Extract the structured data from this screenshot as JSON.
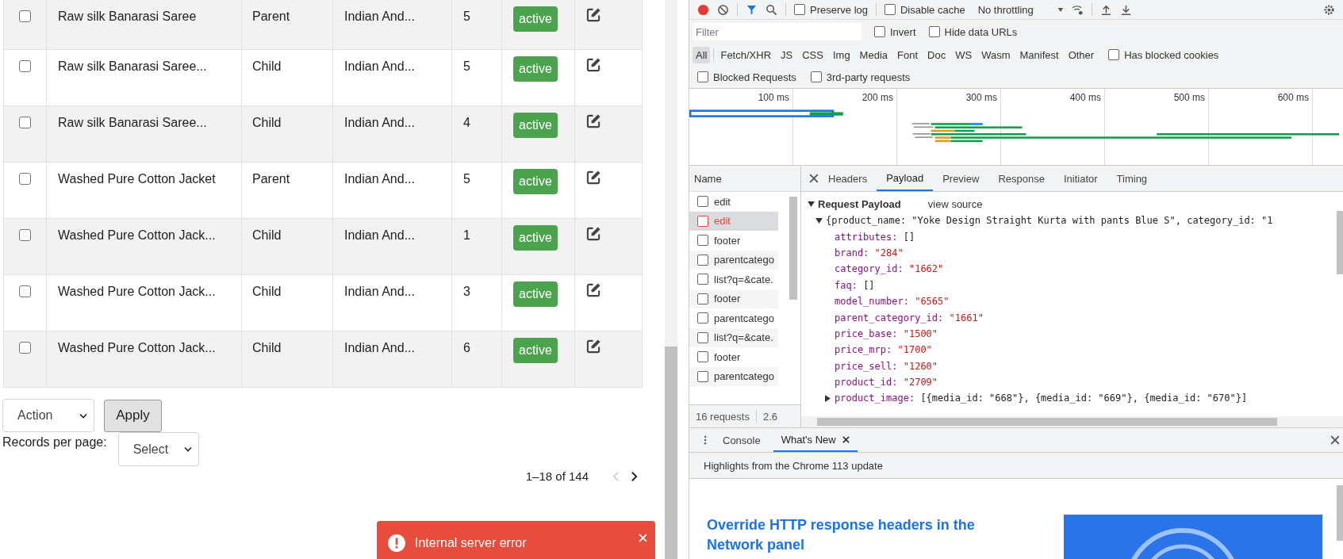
{
  "product_table": {
    "rows": [
      {
        "selected": false,
        "name": "Raw silk Banarasi Saree",
        "type": "Parent",
        "brand": "Indian And...",
        "quantity": "5",
        "status": "active"
      },
      {
        "selected": false,
        "name": "Raw silk Banarasi Saree...",
        "type": "Child",
        "brand": "Indian And...",
        "quantity": "5",
        "status": "active"
      },
      {
        "selected": false,
        "name": "Raw silk Banarasi Saree...",
        "type": "Child",
        "brand": "Indian And...",
        "quantity": "4",
        "status": "active"
      },
      {
        "selected": false,
        "name": "Washed Pure Cotton Jacket",
        "type": "Parent",
        "brand": "Indian And...",
        "quantity": "5",
        "status": "active"
      },
      {
        "selected": false,
        "name": "Washed Pure Cotton Jack...",
        "type": "Child",
        "brand": "Indian And...",
        "quantity": "1",
        "status": "active"
      },
      {
        "selected": false,
        "name": "Washed Pure Cotton Jack...",
        "type": "Child",
        "brand": "Indian And...",
        "quantity": "3",
        "status": "active"
      },
      {
        "selected": false,
        "name": "Washed Pure Cotton Jack...",
        "type": "Child",
        "brand": "Indian And...",
        "quantity": "6",
        "status": "active"
      }
    ]
  },
  "bulk_action": {
    "select": "Action",
    "button": "Apply"
  },
  "records_per_page": {
    "label": "Records per page:",
    "select": "Select"
  },
  "pagination": {
    "range": "1–18 of 144",
    "prev_disabled": true
  },
  "toast": {
    "message": "Internal server error"
  },
  "devtools": {
    "toolbar": {
      "preserve_log": {
        "label": "Preserve log",
        "checked": false
      },
      "disable_cache": {
        "label": "Disable cache",
        "checked": false
      },
      "throttling": "No throttling"
    },
    "filter": {
      "placeholder": "Filter",
      "invert": {
        "label": "Invert",
        "checked": false
      },
      "hide_data_urls": {
        "label": "Hide data URLs",
        "checked": false
      }
    },
    "type_filters": [
      {
        "label": "All",
        "selected": true
      },
      {
        "label": "Fetch/XHR",
        "selected": false
      },
      {
        "label": "JS",
        "selected": false
      },
      {
        "label": "CSS",
        "selected": false
      },
      {
        "label": "Img",
        "selected": false
      },
      {
        "label": "Media",
        "selected": false
      },
      {
        "label": "Font",
        "selected": false
      },
      {
        "label": "Doc",
        "selected": false
      },
      {
        "label": "WS",
        "selected": false
      },
      {
        "label": "Wasm",
        "selected": false
      },
      {
        "label": "Manifest",
        "selected": false
      },
      {
        "label": "Other",
        "selected": false
      }
    ],
    "has_blocked_cookies": {
      "label": "Has blocked cookies",
      "checked": false
    },
    "blocked_requests": {
      "label": "Blocked Requests",
      "checked": false
    },
    "third_party_requests": {
      "label": "3rd-party requests",
      "checked": false
    },
    "overview": {
      "ticks": [
        "100 ms",
        "200 ms",
        "300 ms",
        "400 ms",
        "500 ms",
        "600 ms"
      ]
    },
    "requests": {
      "header": "Name",
      "items": [
        {
          "name": "edit",
          "failed": false,
          "selected": false
        },
        {
          "name": "edit",
          "failed": true,
          "selected": true
        },
        {
          "name": "footer",
          "failed": false,
          "selected": false
        },
        {
          "name": "parentcatego",
          "failed": false,
          "selected": false
        },
        {
          "name": "list?q=&cate.",
          "failed": false,
          "selected": false
        },
        {
          "name": "footer",
          "failed": false,
          "selected": false
        },
        {
          "name": "parentcatego",
          "failed": false,
          "selected": false
        },
        {
          "name": "list?q=&cate.",
          "failed": false,
          "selected": false
        },
        {
          "name": "footer",
          "failed": false,
          "selected": false
        },
        {
          "name": "parentcatego",
          "failed": false,
          "selected": false
        }
      ],
      "count": "16 requests",
      "transferred": "2.6"
    },
    "detail_tabs": [
      {
        "label": "Headers",
        "selected": false
      },
      {
        "label": "Payload",
        "selected": true
      },
      {
        "label": "Preview",
        "selected": false
      },
      {
        "label": "Response",
        "selected": false
      },
      {
        "label": "Initiator",
        "selected": false
      },
      {
        "label": "Timing",
        "selected": false
      }
    ],
    "payload": {
      "title": "Request Payload",
      "view_source": "view source",
      "summary": "{product_name: \"Yoke Design Straight Kurta with pants Blue S\", category_id: \"1",
      "fields": [
        {
          "key": "attributes:",
          "value": "[]",
          "kind": "plain"
        },
        {
          "key": "brand:",
          "value": "\"284\"",
          "kind": "string"
        },
        {
          "key": "category_id:",
          "value": "\"1662\"",
          "kind": "string"
        },
        {
          "key": "faq:",
          "value": "[]",
          "kind": "plain"
        },
        {
          "key": "model_number:",
          "value": "\"6565\"",
          "kind": "string"
        },
        {
          "key": "parent_category_id:",
          "value": "\"1661\"",
          "kind": "string"
        },
        {
          "key": "price_base:",
          "value": "\"1500\"",
          "kind": "string"
        },
        {
          "key": "price_mrp:",
          "value": "\"1700\"",
          "kind": "string"
        },
        {
          "key": "price_sell:",
          "value": "\"1260\"",
          "kind": "string"
        },
        {
          "key": "product_id:",
          "value": "\"2709\"",
          "kind": "string"
        },
        {
          "key": "product_image:",
          "value": "[{media_id: \"668\"}, {media_id: \"669\"}, {media_id: \"670\"}]",
          "kind": "collapsed"
        }
      ]
    },
    "drawer": {
      "tabs": [
        {
          "label": "Console",
          "selected": false,
          "closable": false
        },
        {
          "label": "What's New",
          "selected": true,
          "closable": true
        }
      ],
      "subtitle": "Highlights from the Chrome 113 update",
      "article_title": "Override HTTP response headers in the Network panel"
    }
  }
}
